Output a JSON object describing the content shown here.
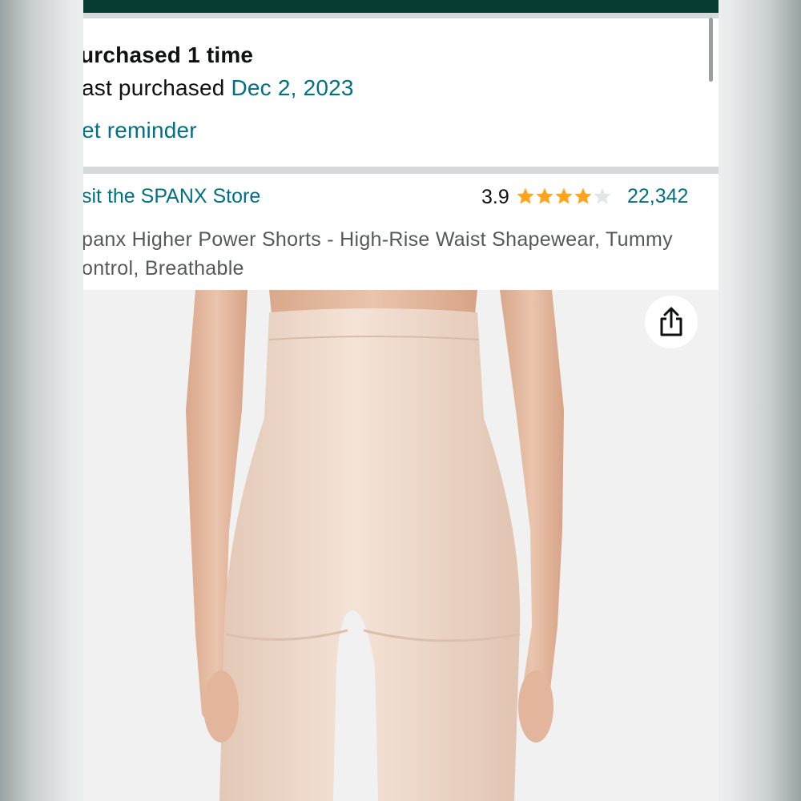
{
  "purchase": {
    "times_label": "urchased 1 time",
    "last_label": "ast purchased ",
    "last_date": "Dec 2, 2023",
    "reminder_label": "et reminder"
  },
  "store": {
    "link_label": "sit the SPANX Store",
    "rating_value": "3.9",
    "rating_stars": 3.9,
    "star_color": "#ffa41c",
    "rating_count": "22,342"
  },
  "product": {
    "title_line1": "panx Higher Power Shorts - High-Rise Waist Shapewear, Tummy",
    "title_line2": "ontrol, Breathable"
  },
  "icons": {
    "share": "share-icon"
  },
  "colors": {
    "top_bar": "#063b32",
    "link": "#007185"
  }
}
